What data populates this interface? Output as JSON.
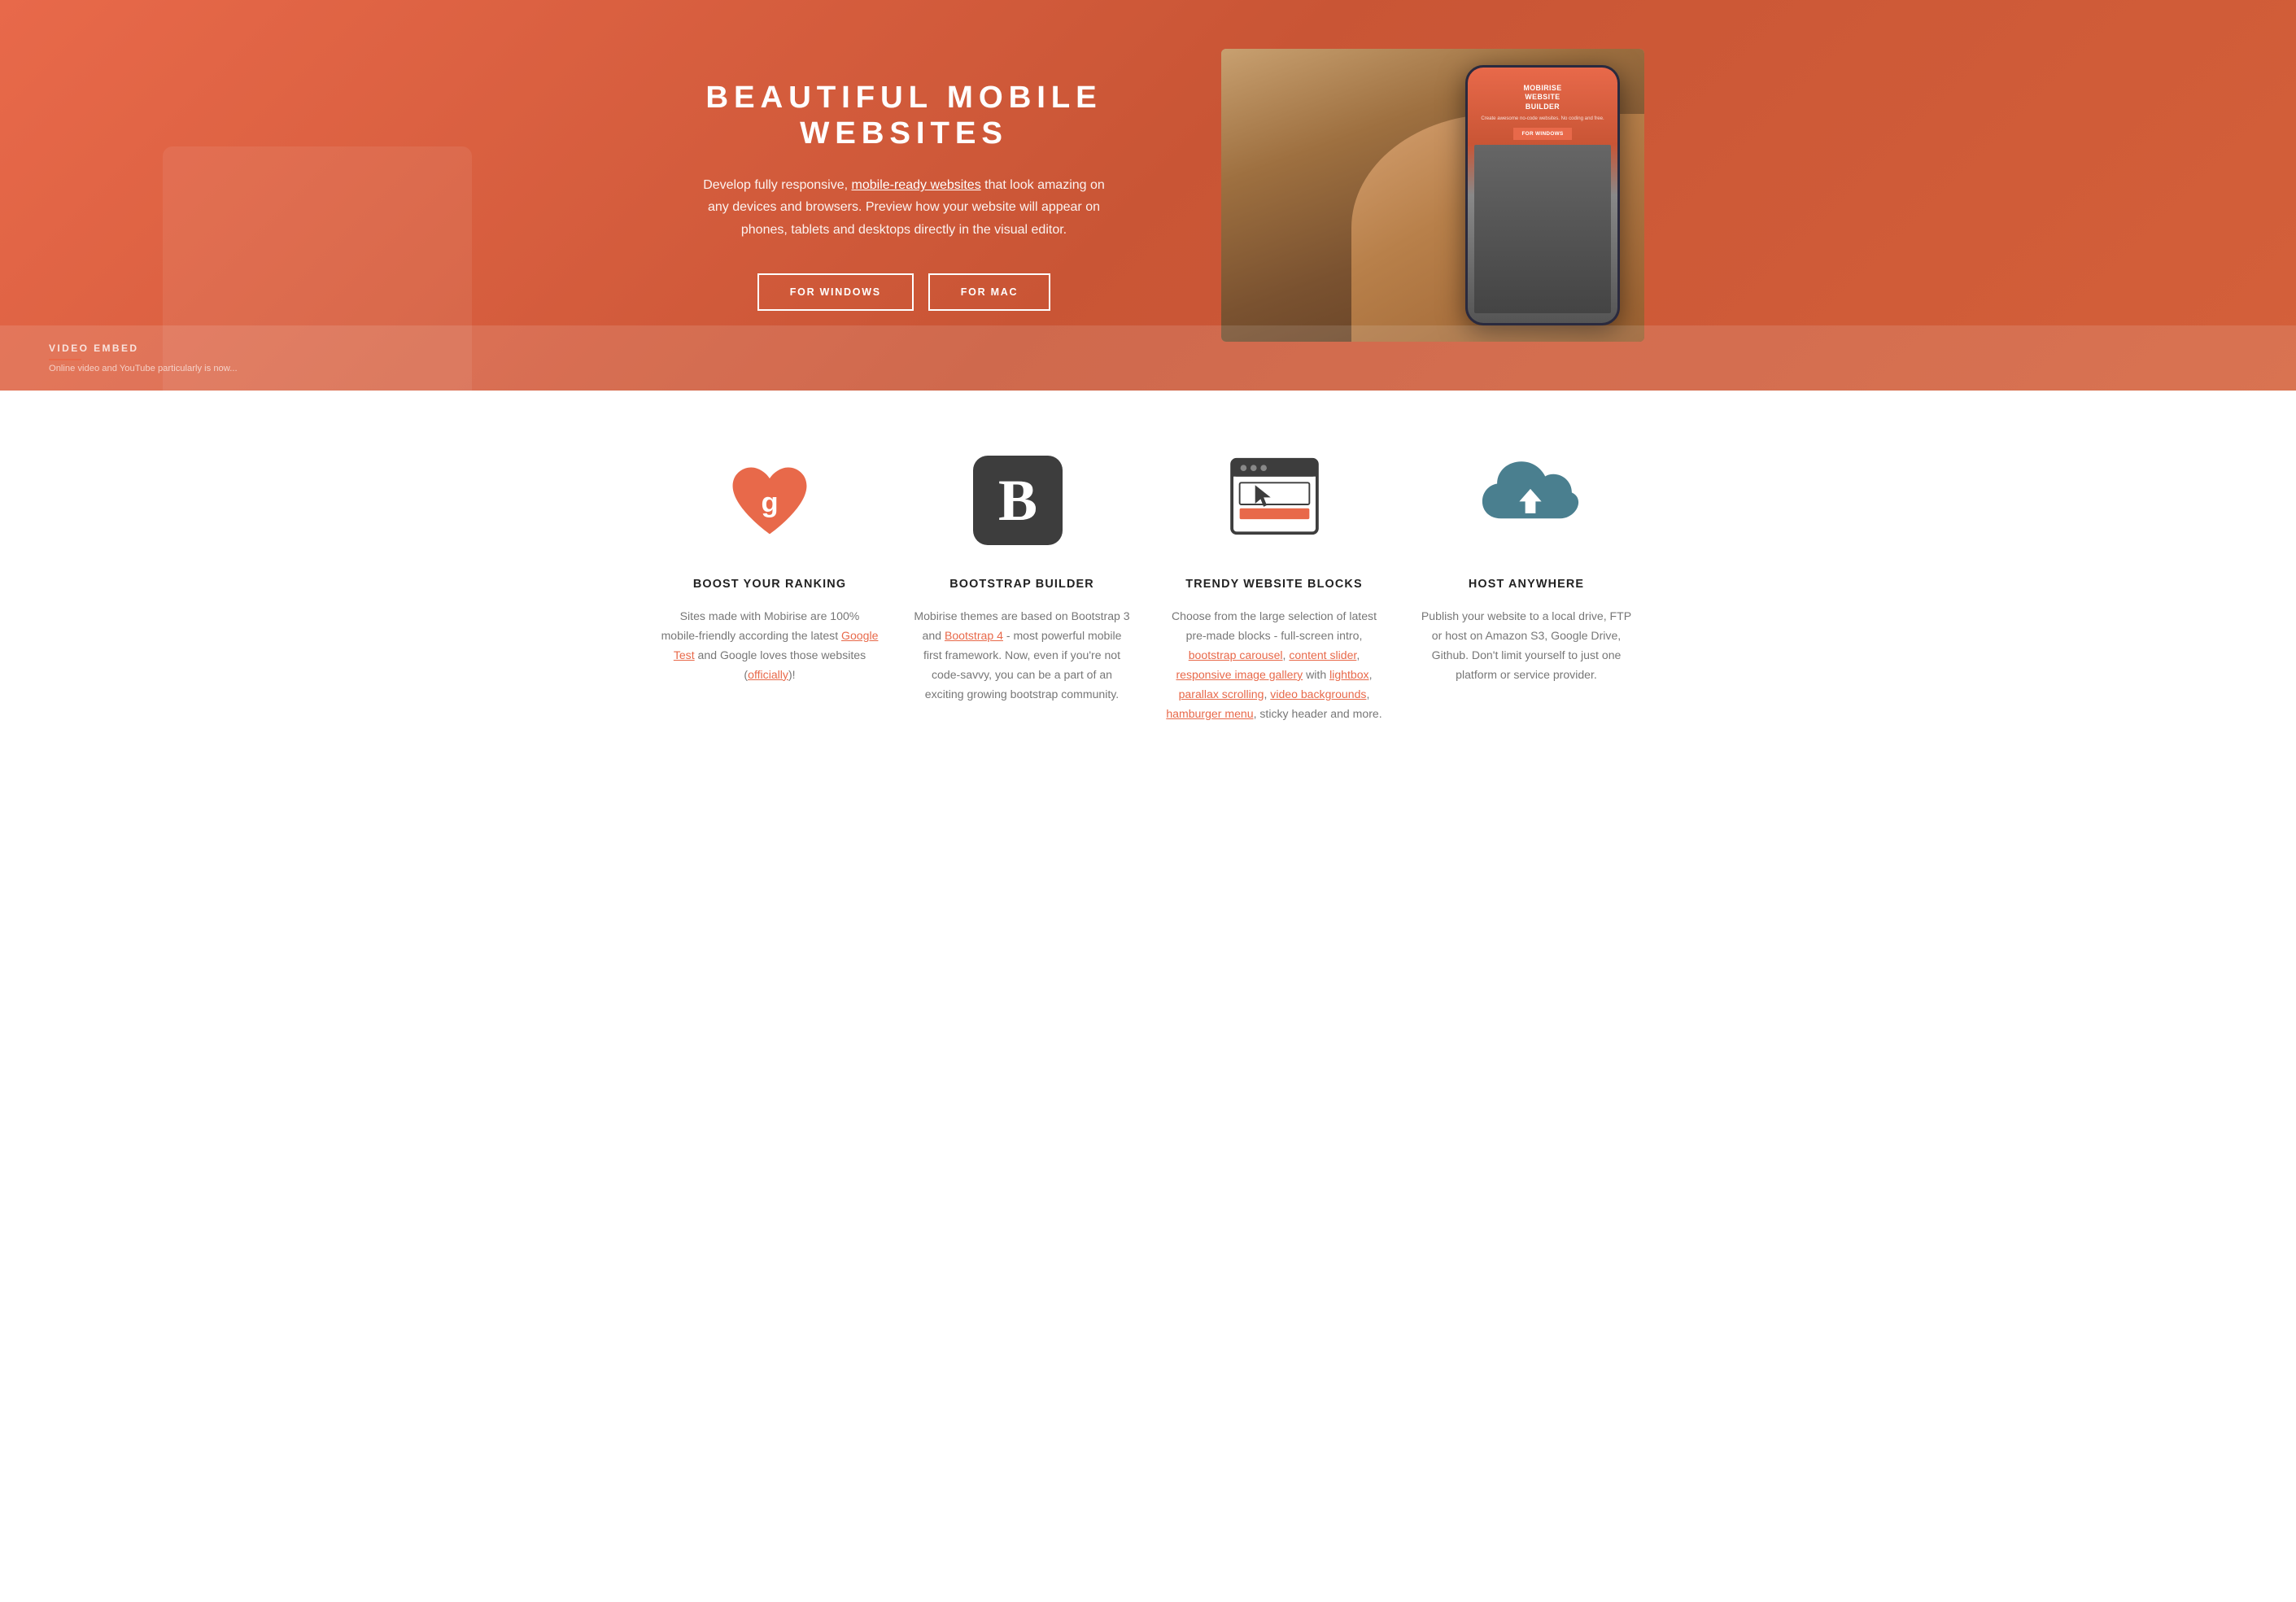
{
  "hero": {
    "title": "BEAUTIFUL MOBILE WEBSITES",
    "description": "Develop fully responsive, mobile-ready websites that look amazing on any devices and browsers. Preview how your website will appear on phones, tablets and desktops directly in the visual editor.",
    "mobile_ready_link": "mobile-ready websites",
    "btn_windows": "FOR WINDOWS",
    "btn_mac": "FOR MAC",
    "phone_screen_title": "MOBIRISE\nWEBSITE\nBUILDER",
    "phone_screen_sub": "Create awesome no-code websites. No coding and free.",
    "phone_cta": "FOR WINDOWS"
  },
  "video_embed": {
    "label": "VIDEO EMBED",
    "description": "Online video and YouTube particularly is now..."
  },
  "features": [
    {
      "id": "boost-ranking",
      "title": "BOOST YOUR RANKING",
      "description": "Sites made with Mobirise are 100% mobile-friendly according the latest Google Test and Google loves those websites (officially)!",
      "links": [
        {
          "text": "Google Test",
          "url": "#"
        },
        {
          "text": "officially",
          "url": "#"
        }
      ]
    },
    {
      "id": "bootstrap-builder",
      "title": "BOOTSTRAP BUILDER",
      "description": "Mobirise themes are based on Bootstrap 3 and Bootstrap 4 - most powerful mobile first framework. Now, even if you're not code-savvy, you can be a part of an exciting growing bootstrap community.",
      "links": [
        {
          "text": "Bootstrap 4",
          "url": "#"
        }
      ]
    },
    {
      "id": "trendy-blocks",
      "title": "TRENDY WEBSITE BLOCKS",
      "description": "Choose from the large selection of latest pre-made blocks - full-screen intro, bootstrap carousel, content slider, responsive image gallery with lightbox, parallax scrolling, video backgrounds, hamburger menu, sticky header and more.",
      "links": [
        {
          "text": "bootstrap carousel",
          "url": "#"
        },
        {
          "text": "content slider",
          "url": "#"
        },
        {
          "text": "responsive image gallery",
          "url": "#"
        },
        {
          "text": "lightbox",
          "url": "#"
        },
        {
          "text": "parallax scrolling",
          "url": "#"
        },
        {
          "text": "video backgrounds",
          "url": "#"
        },
        {
          "text": "hamburger menu",
          "url": "#"
        }
      ]
    },
    {
      "id": "host-anywhere",
      "title": "HOST ANYWHERE",
      "description": "Publish your website to a local drive, FTP or host on Amazon S3, Google Drive, Github. Don't limit yourself to just one platform or service provider.",
      "links": []
    }
  ]
}
